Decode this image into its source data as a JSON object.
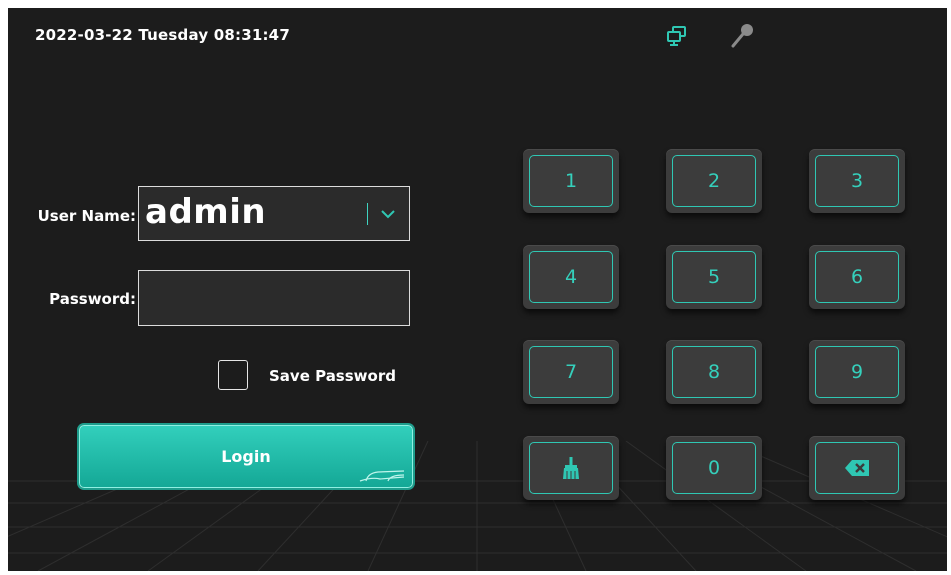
{
  "status_bar": {
    "datetime": "2022-03-22 Tuesday 08:31:47",
    "icons": [
      "network-monitor-icon",
      "microphone-icon"
    ]
  },
  "login_form": {
    "username_label": "User Name:",
    "username_value": "admin",
    "password_label": "Password:",
    "password_value": "",
    "save_password_label": "Save Password",
    "save_password_checked": false,
    "login_label": "Login"
  },
  "keypad": {
    "keys": [
      "1",
      "2",
      "3",
      "4",
      "5",
      "6",
      "7",
      "8",
      "9",
      "clear",
      "0",
      "backspace"
    ],
    "labels": {
      "k1": "1",
      "k2": "2",
      "k3": "3",
      "k4": "4",
      "k5": "5",
      "k6": "6",
      "k7": "7",
      "k8": "8",
      "k9": "9",
      "k0": "0"
    },
    "clear_icon": "broom-icon",
    "backspace_icon": "backspace-icon"
  },
  "colors": {
    "accent": "#2fc7b3",
    "background": "#1c1c1c",
    "key_background": "#3c3c3c",
    "login_button": "#1fb8a5"
  }
}
